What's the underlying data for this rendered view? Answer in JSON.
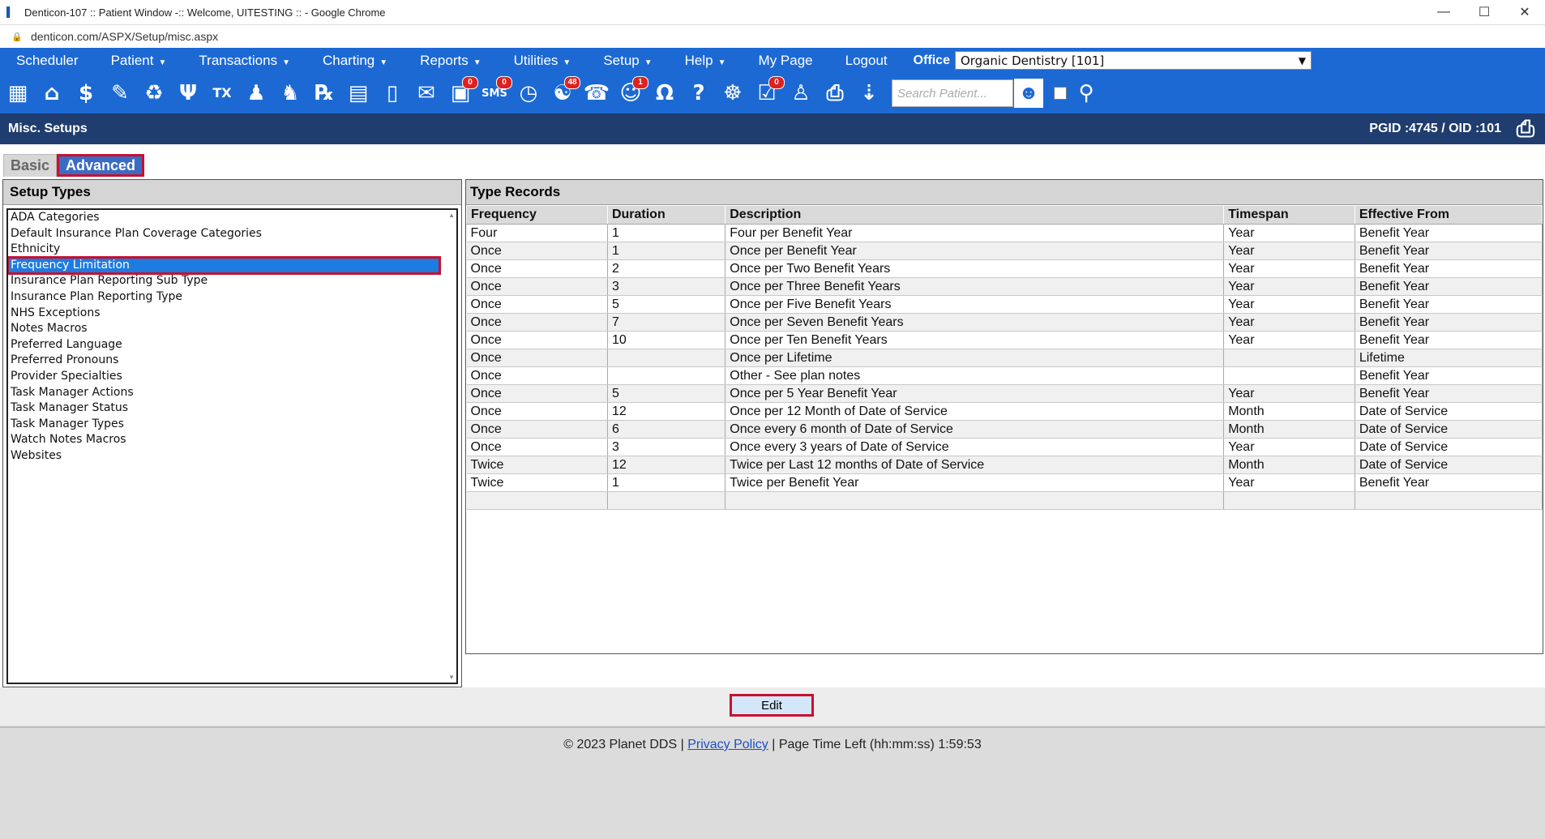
{
  "window": {
    "title": "Denticon-107 :: Patient Window -:: Welcome, UITESTING :: - Google Chrome",
    "url": "denticon.com/ASPX/Setup/misc.aspx"
  },
  "menu": {
    "scheduler": "Scheduler",
    "patient": "Patient",
    "transactions": "Transactions",
    "charting": "Charting",
    "reports": "Reports",
    "utilities": "Utilities",
    "setup": "Setup",
    "help": "Help",
    "mypage": "My Page",
    "logout": "Logout",
    "office_label": "Office",
    "office_value": "Organic Dentistry [101]"
  },
  "toolbar": {
    "messages_badge": "0",
    "sms_label": "SMS",
    "sms_badge": "0",
    "web_badge": "48",
    "user_badge": "1",
    "doc_badge": "0",
    "search_placeholder": "Search Patient..."
  },
  "header": {
    "title": "Misc. Setups",
    "pgid": "PGID :4745  /  OID :101"
  },
  "tabs": {
    "basic": "Basic",
    "advanced": "Advanced"
  },
  "setup_types": {
    "header": "Setup Types",
    "items": [
      "ADA Categories",
      "Default Insurance Plan Coverage Categories",
      "Ethnicity",
      "Frequency Limitation",
      "Insurance Plan Reporting Sub Type",
      "Insurance Plan Reporting Type",
      "NHS Exceptions",
      "Notes Macros",
      "Preferred Language",
      "Preferred Pronouns",
      "Provider Specialties",
      "Task Manager Actions",
      "Task Manager Status",
      "Task Manager Types",
      "Watch Notes Macros",
      "Websites"
    ]
  },
  "type_records": {
    "header": "Type Records",
    "columns": [
      "Frequency",
      "Duration",
      "Description",
      "Timespan",
      "Effective From"
    ],
    "rows": [
      [
        "Four",
        "1",
        "Four per Benefit Year",
        "Year",
        "Benefit Year"
      ],
      [
        "Once",
        "1",
        "Once per Benefit Year",
        "Year",
        "Benefit Year"
      ],
      [
        "Once",
        "2",
        "Once per Two Benefit Years",
        "Year",
        "Benefit Year"
      ],
      [
        "Once",
        "3",
        "Once per Three Benefit Years",
        "Year",
        "Benefit Year"
      ],
      [
        "Once",
        "5",
        "Once per Five Benefit Years",
        "Year",
        "Benefit Year"
      ],
      [
        "Once",
        "7",
        "Once per Seven Benefit Years",
        "Year",
        "Benefit Year"
      ],
      [
        "Once",
        "10",
        "Once per Ten Benefit Years",
        "Year",
        "Benefit Year"
      ],
      [
        "Once",
        "",
        "Once per Lifetime",
        "",
        "Lifetime"
      ],
      [
        "Once",
        "",
        "Other - See plan notes",
        "",
        "Benefit Year"
      ],
      [
        "Once",
        "5",
        "Once per 5 Year Benefit Year",
        "Year",
        "Benefit Year"
      ],
      [
        "Once",
        "12",
        "Once per 12 Month of Date of Service",
        "Month",
        "Date of Service"
      ],
      [
        "Once",
        "6",
        "Once every 6 month of Date of Service",
        "Month",
        "Date of Service"
      ],
      [
        "Once",
        "3",
        "Once every 3 years of Date of Service",
        "Year",
        "Date of Service"
      ],
      [
        "Twice",
        "12",
        "Twice per Last 12 months of Date of Service",
        "Month",
        "Date of Service"
      ],
      [
        "Twice",
        "1",
        "Twice per Benefit Year",
        "Year",
        "Benefit Year"
      ],
      [
        "",
        "",
        "",
        "",
        ""
      ]
    ]
  },
  "actions": {
    "edit": "Edit"
  },
  "footer": {
    "copyright": "© 2023 Planet DDS |",
    "privacy": "Privacy Policy",
    "time_left": "|  Page Time Left (hh:mm:ss) 1:59:53"
  }
}
